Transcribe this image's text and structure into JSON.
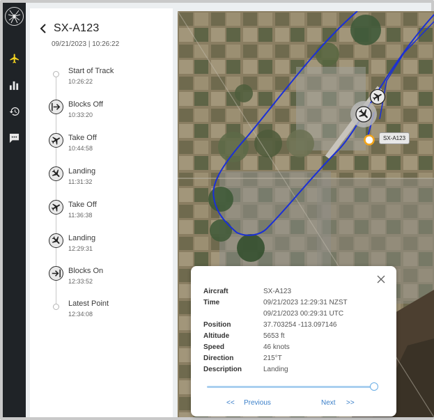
{
  "sidebar": {
    "items": [
      {
        "name": "flights",
        "icon": "airplane-icon",
        "active": true
      },
      {
        "name": "reports",
        "icon": "bar-chart-icon",
        "active": false
      },
      {
        "name": "history",
        "icon": "history-icon",
        "active": false
      },
      {
        "name": "messages",
        "icon": "chat-icon",
        "active": false
      }
    ],
    "accent": "#f3d21e"
  },
  "panel": {
    "title": "SX-A123",
    "subtitle": "09/21/2023 | 10:26:22",
    "events": [
      {
        "name": "Start of Track",
        "time": "10:26:22",
        "icon": "dot"
      },
      {
        "name": "Blocks Off",
        "time": "10:33:20",
        "icon": "blocks-off-icon"
      },
      {
        "name": "Take Off",
        "time": "10:44:58",
        "icon": "takeoff-icon"
      },
      {
        "name": "Landing",
        "time": "11:31:32",
        "icon": "landing-icon"
      },
      {
        "name": "Take Off",
        "time": "11:36:38",
        "icon": "takeoff-icon"
      },
      {
        "name": "Landing",
        "time": "12:29:31",
        "icon": "landing-icon"
      },
      {
        "name": "Blocks On",
        "time": "12:33:52",
        "icon": "blocks-on-icon"
      },
      {
        "name": "Latest Point",
        "time": "12:34:08",
        "icon": "dot"
      }
    ]
  },
  "map": {
    "aircraft_tag": "SX-A123",
    "track_color": "#1a2fd8"
  },
  "popup": {
    "rows": [
      {
        "label": "Aircraft",
        "value": "SX-A123"
      },
      {
        "label": "Time",
        "value": "09/21/2023 12:29:31 NZST"
      },
      {
        "label": "",
        "value": "09/21/2023 00:29:31 UTC"
      },
      {
        "label": "Position",
        "value": "37.703254 -113.097146"
      },
      {
        "label": "Altitude",
        "value": "5653 ft"
      },
      {
        "label": "Speed",
        "value": "46 knots"
      },
      {
        "label": "Direction",
        "value": "215°T"
      },
      {
        "label": "Description",
        "value": "Landing"
      }
    ],
    "slider_fraction": 1.0,
    "prev_arrows": "<<",
    "prev_label": "Previous",
    "next_label": "Next",
    "next_arrows": ">>"
  }
}
